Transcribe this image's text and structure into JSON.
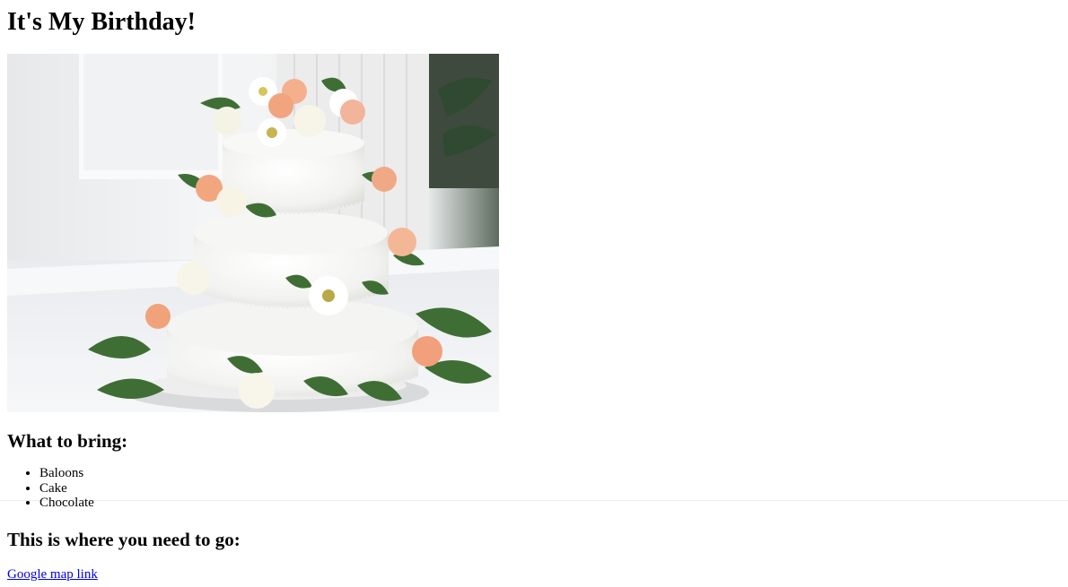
{
  "page": {
    "title": "It's My Birthday!",
    "image_description_icon": "cake-photo"
  },
  "bring": {
    "heading": "What to bring:",
    "items": [
      "Baloons",
      "Cake",
      "Chocolate"
    ]
  },
  "location": {
    "heading": "This is where you need to go:",
    "link_text": "Google map link"
  },
  "colors": {
    "link": "#0000ee",
    "text": "#000000",
    "background": "#ffffff"
  }
}
